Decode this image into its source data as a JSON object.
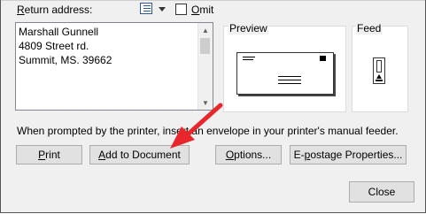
{
  "return_address": {
    "label": "Return address:",
    "lines": [
      "Marshall Gunnell",
      "4809 Street rd.",
      "Summit, MS. 39662"
    ]
  },
  "omit": {
    "label": "Omit",
    "checked": false
  },
  "preview": {
    "label": "Preview"
  },
  "feed": {
    "label": "Feed"
  },
  "instruction": "When prompted by the printer, insert an envelope in your printer's manual feeder.",
  "buttons": {
    "print": "Print",
    "add_to_document": "Add to Document",
    "options": "Options...",
    "epostage": "E-postage Properties...",
    "close": "Close"
  },
  "icons": {
    "address_book": "address-book-icon",
    "dropdown": "chevron-down-icon",
    "arrow": "red-arrow-annotation"
  },
  "colors": {
    "annotation_arrow": "#e8262b"
  }
}
